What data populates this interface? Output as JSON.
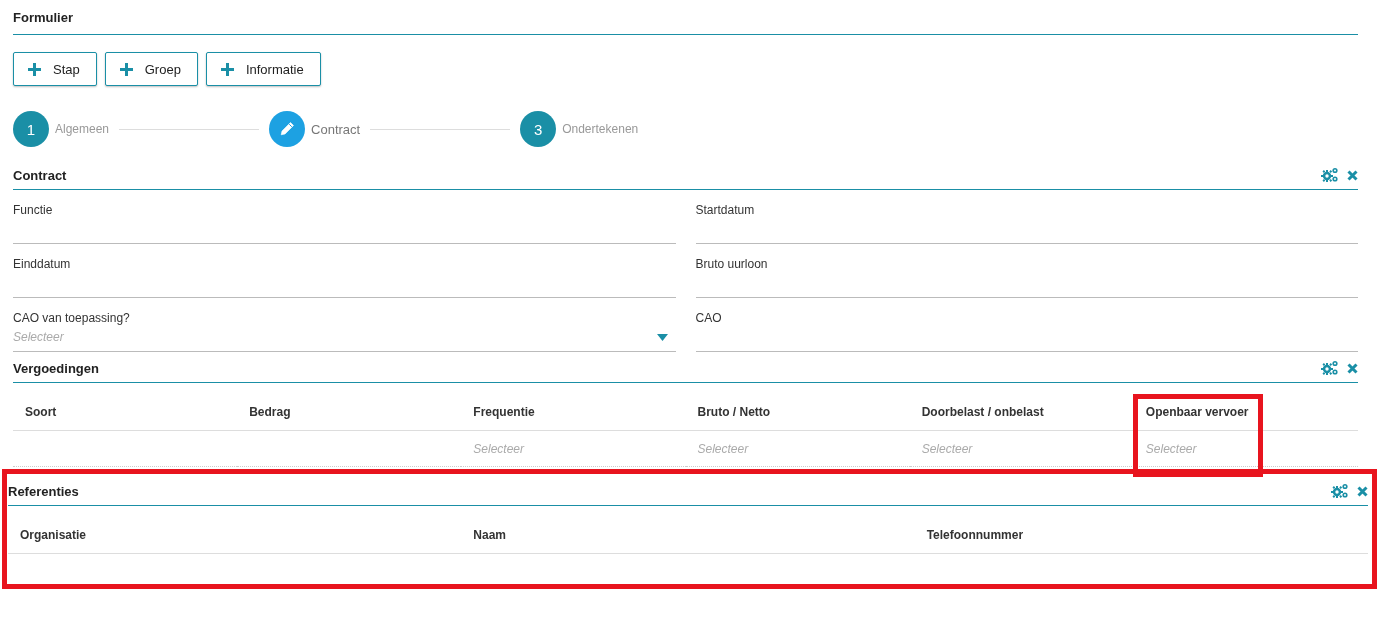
{
  "page": {
    "title": "Formulier"
  },
  "add_buttons": [
    {
      "label": "Stap"
    },
    {
      "label": "Groep"
    },
    {
      "label": "Informatie"
    }
  ],
  "stepper": [
    {
      "kind": "number",
      "number": "1",
      "label": "Algemeen",
      "selected": false
    },
    {
      "kind": "edit",
      "label": "Contract",
      "selected": true
    },
    {
      "kind": "number",
      "number": "3",
      "label": "Ondertekenen",
      "selected": false
    }
  ],
  "sections": [
    {
      "kind": "fields",
      "title": "Contract",
      "highlighted": false,
      "fields": [
        {
          "label": "Functie"
        },
        {
          "label": "Startdatum"
        },
        {
          "label": "Einddatum"
        },
        {
          "label": "Bruto uurloon"
        },
        {
          "label": "CAO van toepassing?",
          "kind": "select",
          "placeholder": "Selecteer"
        },
        {
          "label": "CAO"
        }
      ]
    },
    {
      "kind": "table",
      "title": "Vergoedingen",
      "highlighted": false,
      "columns": [
        {
          "label": "Soort",
          "highlighted": false
        },
        {
          "label": "Bedrag",
          "highlighted": false
        },
        {
          "label": "Frequentie",
          "highlighted": false
        },
        {
          "label": "Bruto / Netto",
          "highlighted": false
        },
        {
          "label": "Doorbelast / onbelast",
          "highlighted": false
        },
        {
          "label": "Openbaar vervoer",
          "highlighted": true
        }
      ],
      "rows": [
        {
          "cells": [
            {},
            {},
            {
              "placeholder": "Selecteer"
            },
            {
              "placeholder": "Selecteer"
            },
            {
              "placeholder": "Selecteer"
            },
            {
              "placeholder": "Selecteer"
            }
          ]
        }
      ]
    },
    {
      "kind": "table",
      "title": "Referenties",
      "highlighted": true,
      "columns": [
        {
          "label": "Organisatie",
          "highlighted": false
        },
        {
          "label": "Naam",
          "highlighted": false
        },
        {
          "label": "Telefoonnummer",
          "highlighted": false
        }
      ]
    }
  ]
}
